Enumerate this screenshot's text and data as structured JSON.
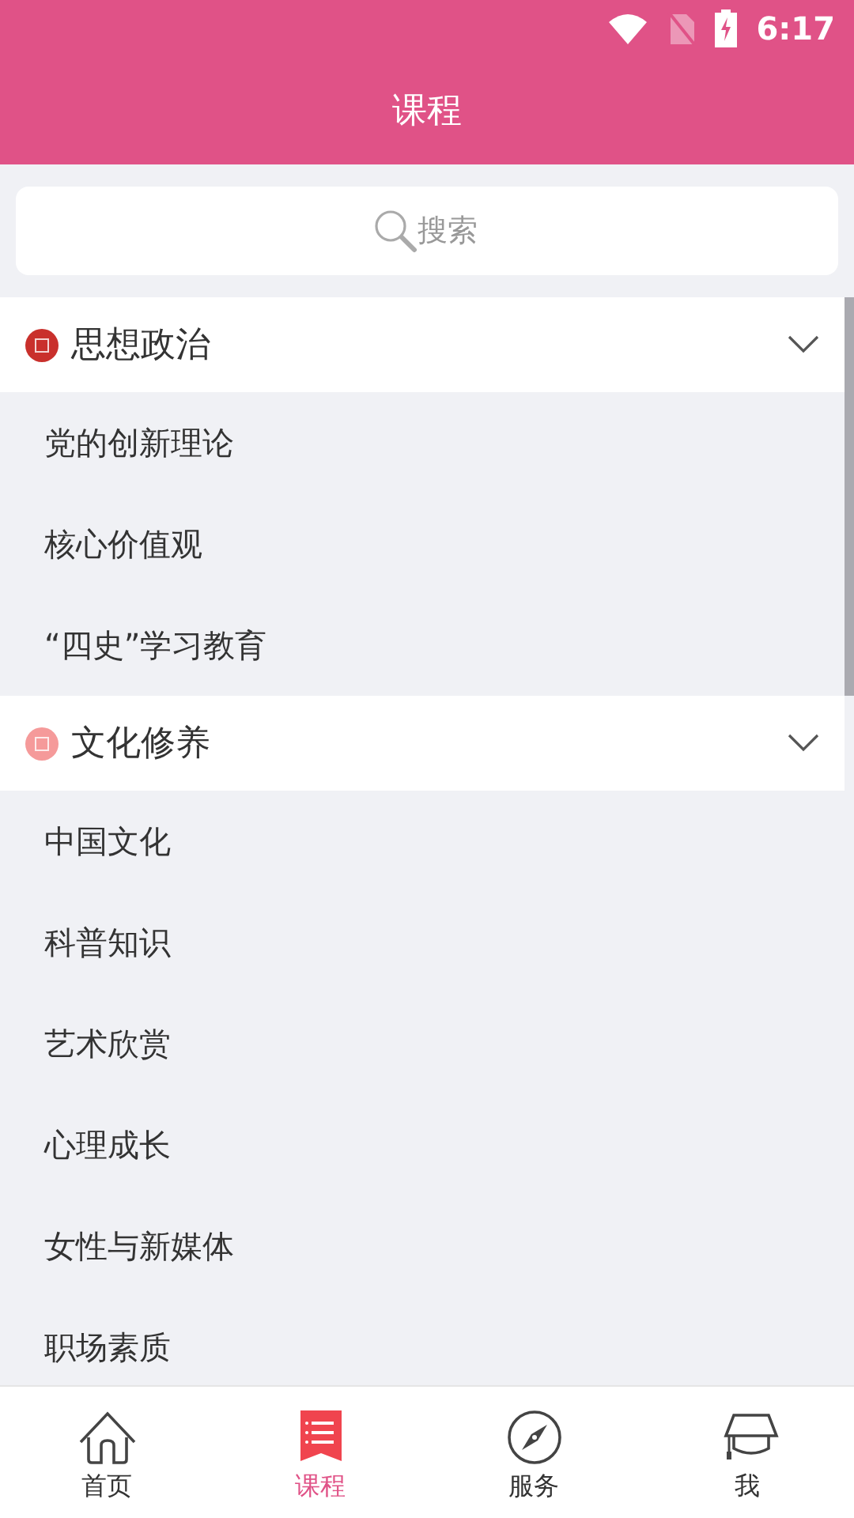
{
  "status_bar": {
    "time": "6:17"
  },
  "header": {
    "title": "课程"
  },
  "search": {
    "placeholder": "搜索"
  },
  "categories": [
    {
      "title": "思想政治",
      "color": "#c9302c",
      "expanded": true,
      "items": [
        "党的创新理论",
        "核心价值观",
        "“四史”学习教育"
      ]
    },
    {
      "title": "文化修养",
      "color": "#f59a9a",
      "expanded": true,
      "items": [
        "中国文化",
        "科普知识",
        "艺术欣赏",
        "心理成长",
        "女性与新媒体",
        "职场素质"
      ]
    }
  ],
  "bottom_nav": [
    {
      "label": "首页",
      "kind": "home",
      "selected": false
    },
    {
      "label": "课程",
      "kind": "list",
      "selected": true
    },
    {
      "label": "服务",
      "kind": "compass",
      "selected": false
    },
    {
      "label": "我",
      "kind": "cap",
      "selected": false
    }
  ]
}
